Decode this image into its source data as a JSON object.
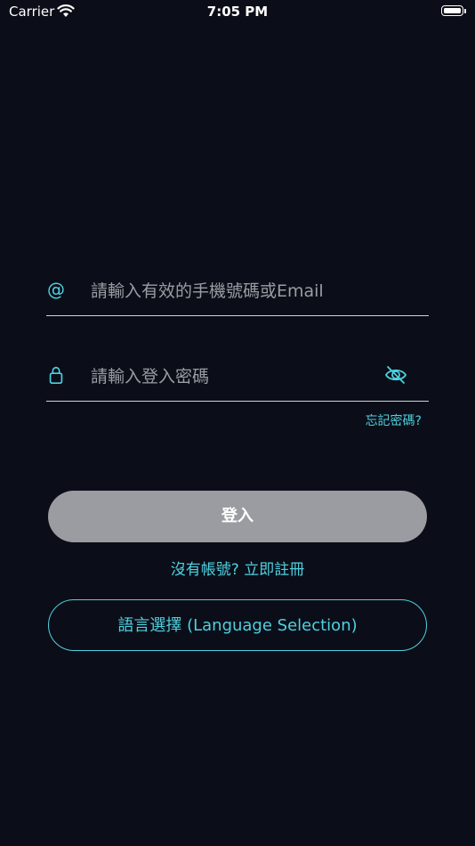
{
  "status_bar": {
    "carrier": "Carrier",
    "time": "7:05 PM",
    "icons": [
      "wifi-icon",
      "battery-icon"
    ]
  },
  "login_form": {
    "email_field": {
      "icon_glyph": "@",
      "icon": "at-icon",
      "placeholder": "請輸入有效的手機號碼或Email",
      "value": ""
    },
    "password_field": {
      "icon": "lock-icon",
      "placeholder": "請輸入登入密碼",
      "value": "",
      "toggle_icon": "eye-slash-icon"
    },
    "forgot_password": "忘記密碼?",
    "login_button": "登入",
    "register_link": "沒有帳號? 立即註冊",
    "language_button": "語言選擇 (Language Selection)"
  },
  "colors": {
    "background": "#0b0e18",
    "accent": "#4fd0e0",
    "button_disabled": "#9b9ca1",
    "placeholder": "#9a9ca3",
    "divider": "#cfd3da"
  }
}
